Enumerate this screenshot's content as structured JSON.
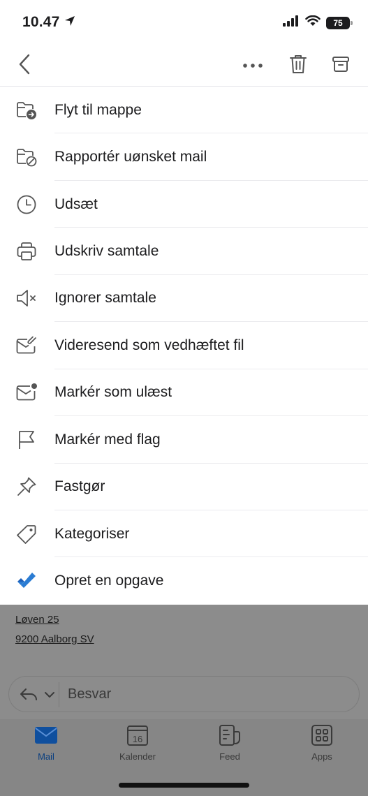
{
  "status": {
    "time": "10.47",
    "battery": "75"
  },
  "toolbar": {
    "back": "back",
    "more": "more",
    "trash": "trash",
    "archive": "archive"
  },
  "menu": {
    "items": [
      {
        "label": "Flyt til mappe",
        "icon": "folder-move-icon"
      },
      {
        "label": "Rapportér uønsket mail",
        "icon": "folder-blocked-icon"
      },
      {
        "label": "Udsæt",
        "icon": "clock-icon"
      },
      {
        "label": "Udskriv samtale",
        "icon": "printer-icon"
      },
      {
        "label": "Ignorer samtale",
        "icon": "speaker-mute-icon"
      },
      {
        "label": "Videresend som vedhæftet fil",
        "icon": "mail-attach-icon"
      },
      {
        "label": "Markér som ulæst",
        "icon": "mail-unread-icon"
      },
      {
        "label": "Markér med flag",
        "icon": "flag-icon"
      },
      {
        "label": "Fastgør",
        "icon": "pin-icon"
      },
      {
        "label": "Kategoriser",
        "icon": "tag-icon"
      },
      {
        "label": "Opret en opgave",
        "icon": "todo-check-icon"
      }
    ]
  },
  "background": {
    "address_line1": "Løven 25",
    "address_line2": "9200 Aalborg SV"
  },
  "reply": {
    "label": "Besvar"
  },
  "tabs": [
    {
      "label": "Mail",
      "active": true
    },
    {
      "label": "Kalender",
      "date": "16"
    },
    {
      "label": "Feed"
    },
    {
      "label": "Apps"
    }
  ],
  "colors": {
    "accent": "#1467c9",
    "todo_check": "#2b7cd3",
    "dim_overlay": "#8c8c8c"
  }
}
